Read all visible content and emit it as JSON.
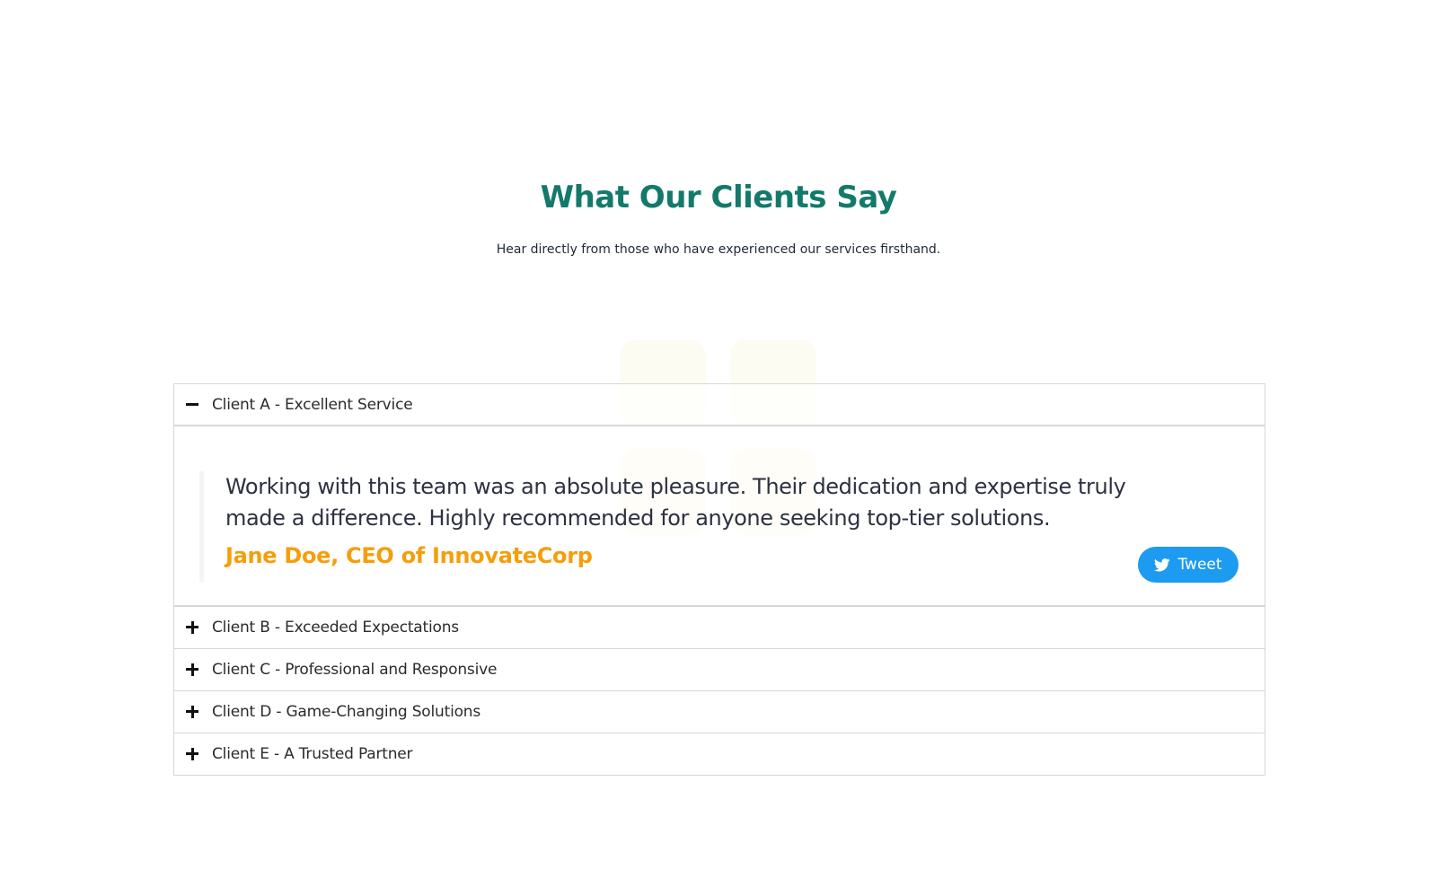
{
  "section": {
    "title": "What Our Clients Say",
    "subtitle": "Hear directly from those who have experienced our services firsthand."
  },
  "accordion": {
    "items": [
      {
        "title": "Client A - Excellent Service",
        "expanded": true,
        "icon": "minus-icon",
        "quote": "Working with this team was an absolute pleasure. Their dedication and expertise truly made a difference. Highly recommended for anyone seeking top-tier solutions.",
        "author": "Jane Doe, CEO of InnovateCorp",
        "tweet_label": "Tweet"
      },
      {
        "title": "Client B - Exceeded Expectations",
        "expanded": false,
        "icon": "plus-icon"
      },
      {
        "title": "Client C - Professional and Responsive",
        "expanded": false,
        "icon": "plus-icon"
      },
      {
        "title": "Client D - Game-Changing Solutions",
        "expanded": false,
        "icon": "plus-icon"
      },
      {
        "title": "Client E - A Trusted Partner",
        "expanded": false,
        "icon": "plus-icon"
      }
    ]
  },
  "colors": {
    "heading": "#137a6b",
    "author": "#f59e0b",
    "tweet_button": "#1d9bf0",
    "border": "#d7d7d7"
  }
}
